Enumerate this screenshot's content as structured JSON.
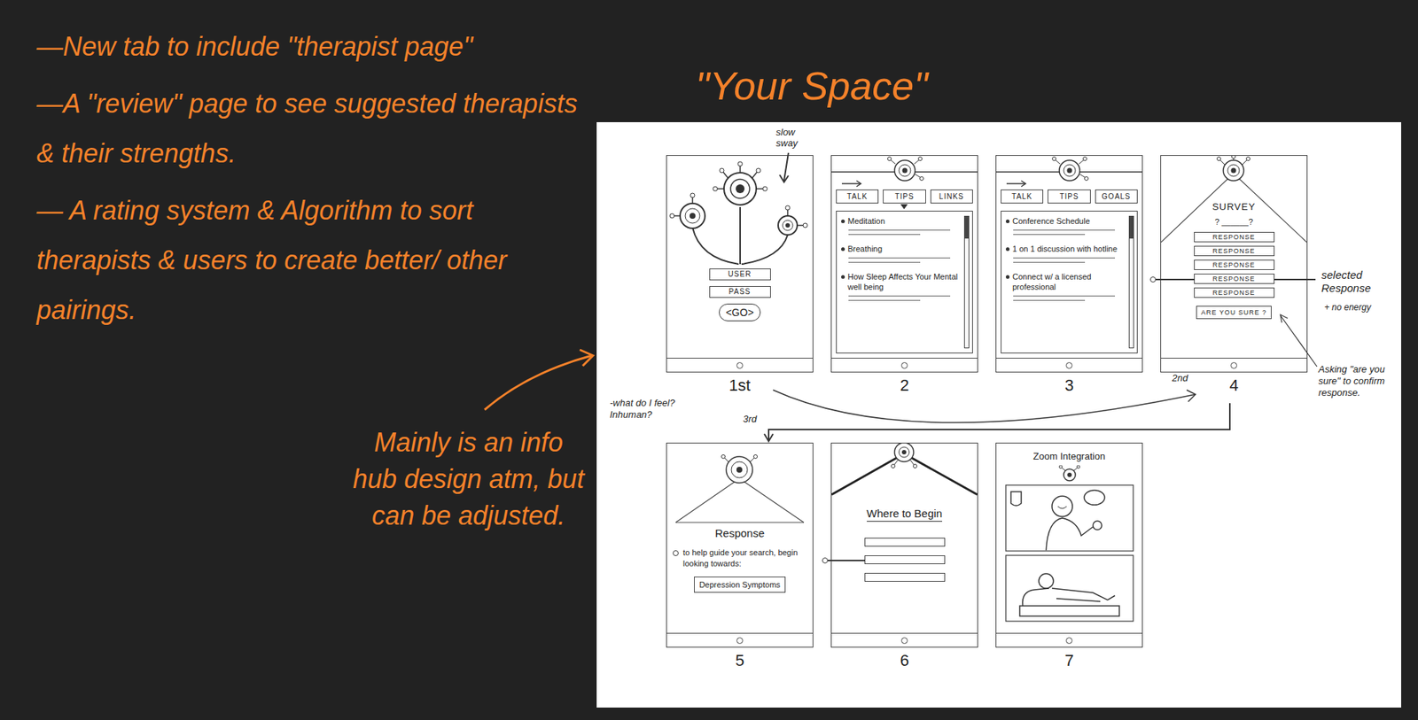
{
  "notes": [
    "—New tab to include \"therapist page\"",
    "—A \"review\" page to see suggested therapists & their strengths.",
    "— A rating system & Algorithm to sort therapists & users to create better/ other pairings."
  ],
  "title": "\"Your Space\"",
  "side_note": "Mainly is an info hub design atm, but can be adjusted.",
  "annotations": {
    "sway": "slow sway",
    "selected": "selected Response",
    "energy": "+ no energy",
    "confirm": "Asking \"are you sure\" to confirm response.",
    "feel": "-what do I feel? Inhuman?",
    "second": "2nd",
    "third": "3rd"
  },
  "screens": [
    {
      "number": "1st",
      "kind": "login",
      "fields": [
        "USER",
        "PASS"
      ],
      "button": "<GO>"
    },
    {
      "number": "2",
      "kind": "tabs",
      "tabs": [
        {
          "label": "TALK",
          "selected": false
        },
        {
          "label": "TIPS",
          "selected": true
        },
        {
          "label": "LINKS",
          "selected": false
        }
      ],
      "items": [
        "Meditation",
        "Breathing",
        "How Sleep Affects Your Mental well being"
      ]
    },
    {
      "number": "3",
      "kind": "tabs",
      "tabs": [
        {
          "label": "TALK",
          "selected": false
        },
        {
          "label": "TIPS",
          "selected": false
        },
        {
          "label": "GOALS",
          "selected": false
        }
      ],
      "items": [
        "Conference Schedule",
        "1 on 1 discussion with hotline",
        "Connect w/ a licensed professional"
      ]
    },
    {
      "number": "4",
      "kind": "survey",
      "heading": "SURVEY",
      "question": "? ______?",
      "responses": [
        {
          "label": "RESPONSE",
          "selected": false
        },
        {
          "label": "RESPONSE",
          "selected": false
        },
        {
          "label": "RESPONSE",
          "selected": false
        },
        {
          "label": "RESPONSE",
          "selected": true
        },
        {
          "label": "RESPONSE",
          "selected": false
        }
      ],
      "button": "ARE YOU SURE ?"
    },
    {
      "number": "5",
      "kind": "response",
      "heading": "Response",
      "body": "to help guide your search, begin looking towards:",
      "result": "Depression Symptoms"
    },
    {
      "number": "6",
      "kind": "begin",
      "heading": "Where to Begin",
      "options": [
        {
          "selected": false
        },
        {
          "selected": true
        },
        {
          "selected": false
        }
      ]
    },
    {
      "number": "7",
      "kind": "video",
      "heading": "Zoom Integration"
    }
  ]
}
